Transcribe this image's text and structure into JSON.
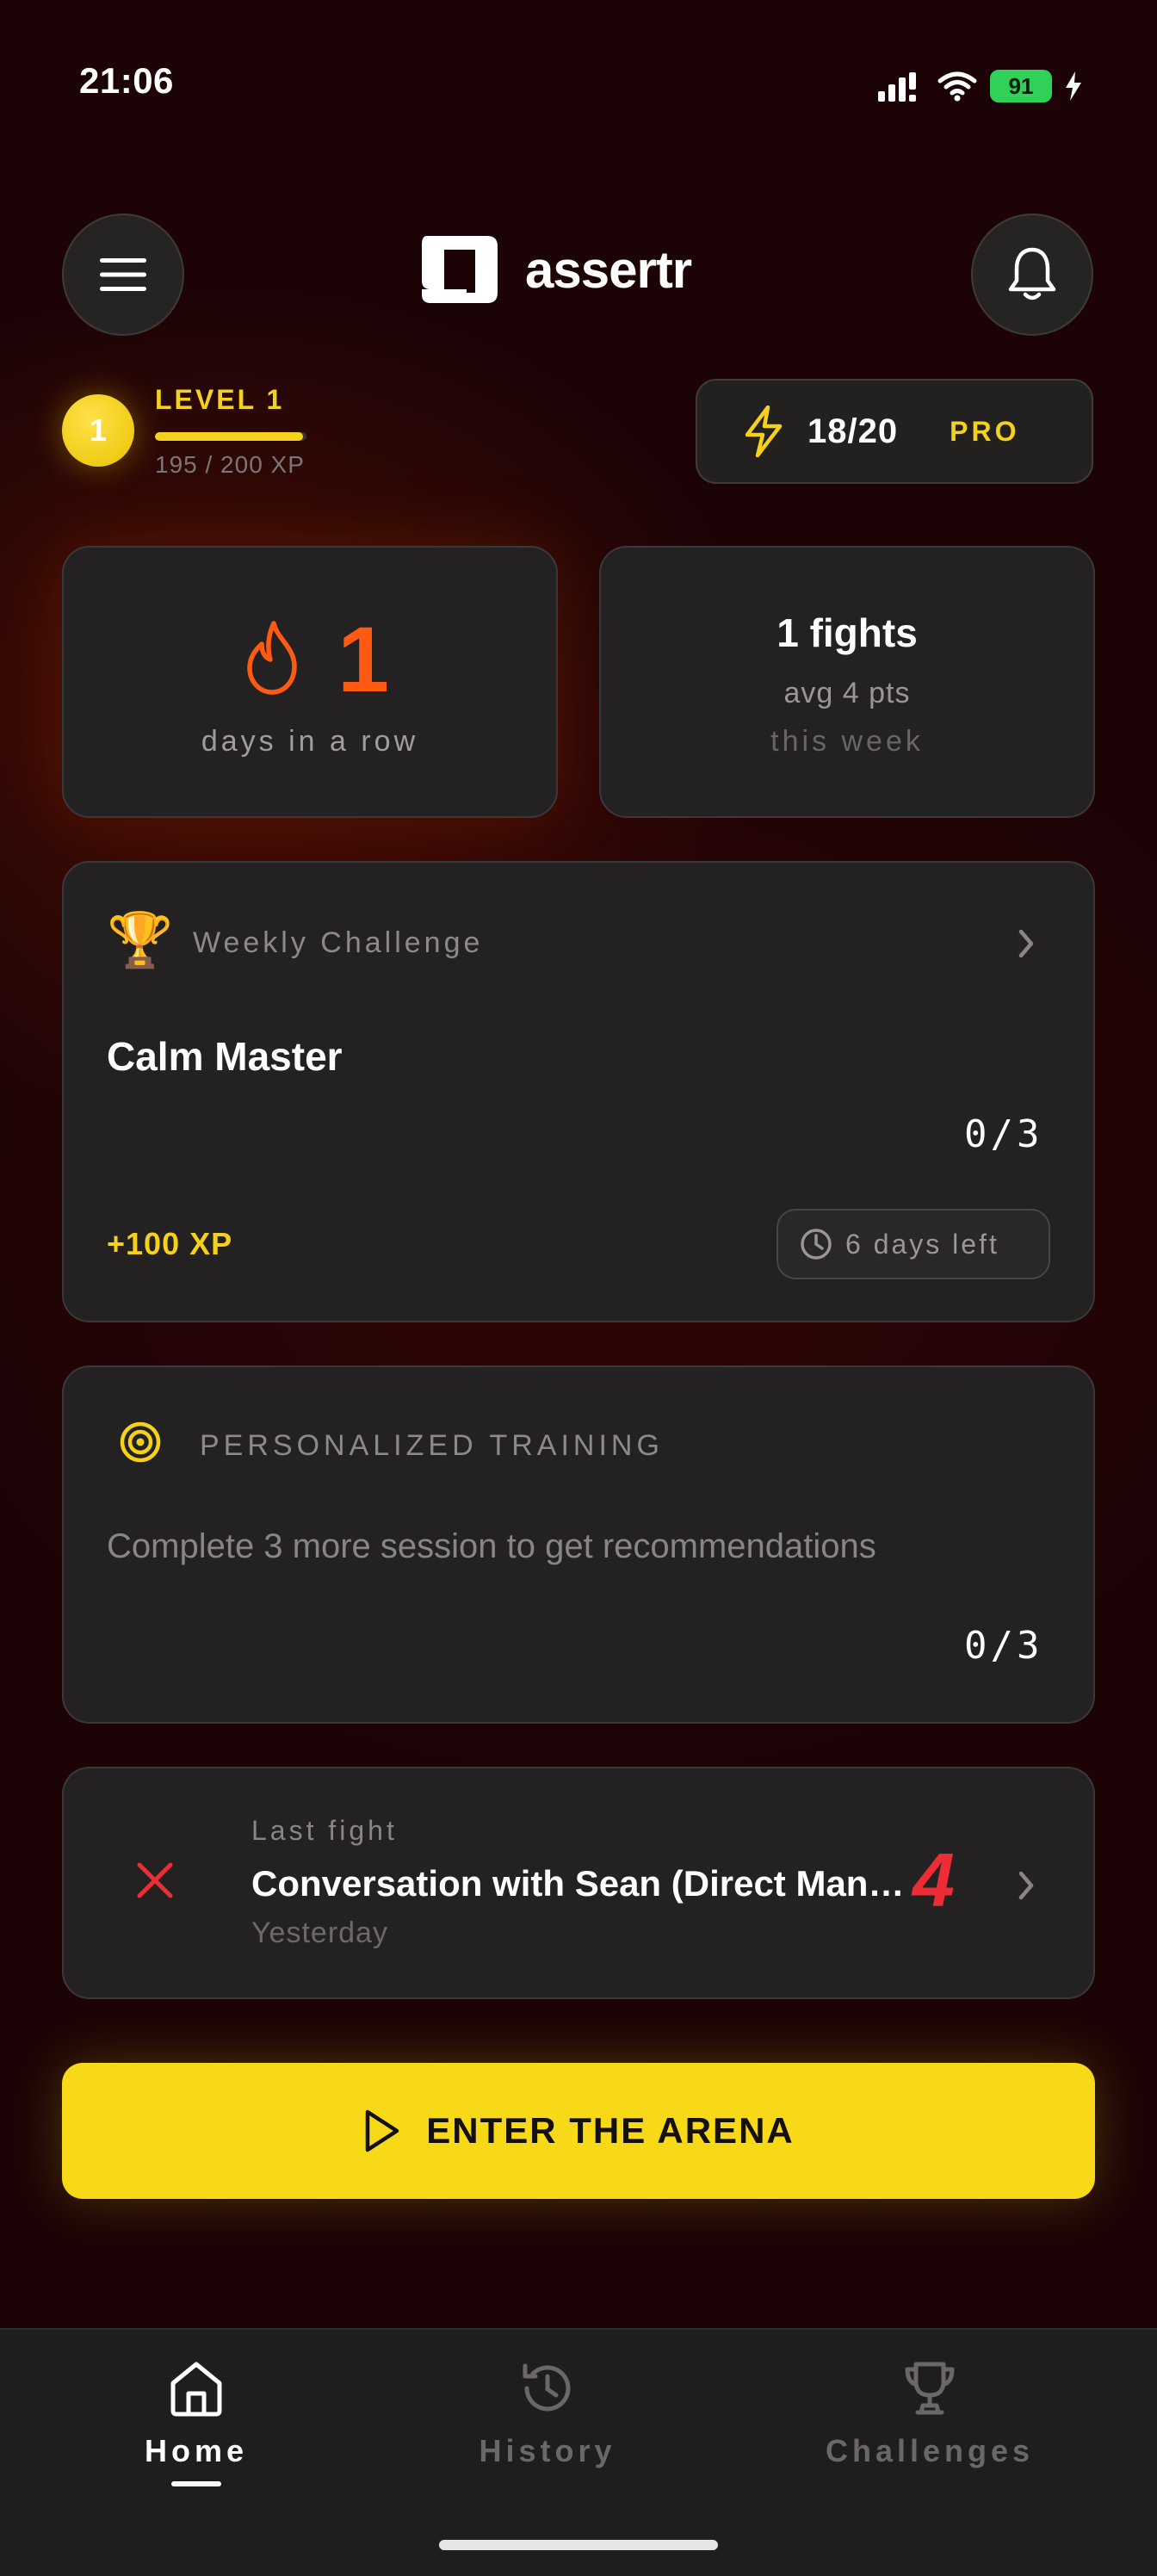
{
  "status_bar": {
    "time": "21:06",
    "battery": "91"
  },
  "header": {
    "app_name": "assertr"
  },
  "level": {
    "number": "1",
    "label": "LEVEL 1",
    "xp_text": "195 / 200 XP",
    "xp_progress": 0.975
  },
  "energy": {
    "count": "18/20",
    "badge": "PRO"
  },
  "streak": {
    "value": "1",
    "label": "days in a row"
  },
  "fights": {
    "title": "1 fights",
    "avg": "avg 4 pts",
    "period": "this week"
  },
  "weekly_challenge": {
    "label": "Weekly Challenge",
    "title": "Calm Master",
    "progress": "0/3",
    "reward": "+100 XP",
    "time_left": "6 days left"
  },
  "training": {
    "label": "PERSONALIZED TRAINING",
    "message": "Complete 3 more session to get recommendations",
    "progress": "0/3"
  },
  "last_fight": {
    "label": "Last fight",
    "title": "Conversation with Sean (Direct Manager)",
    "date": "Yesterday",
    "score": "4"
  },
  "cta": {
    "label": "ENTER THE ARENA"
  },
  "nav": {
    "items": [
      {
        "label": "Home",
        "icon": "home-icon",
        "active": true
      },
      {
        "label": "History",
        "icon": "history-icon",
        "active": false
      },
      {
        "label": "Challenges",
        "icon": "trophy-icon",
        "active": false
      }
    ]
  },
  "colors": {
    "accent": "#f7d917",
    "streak": "#ff5a12",
    "danger": "#ec2d36",
    "background": "#1c0406"
  }
}
